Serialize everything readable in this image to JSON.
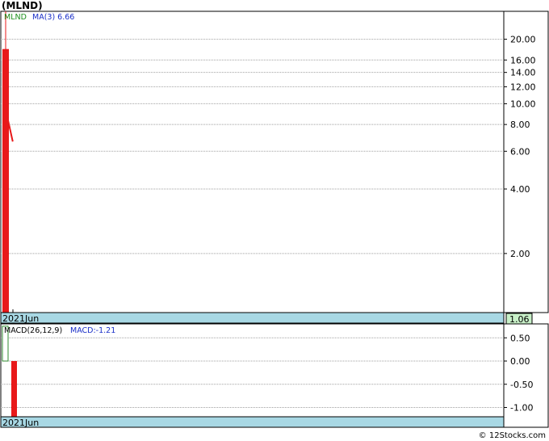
{
  "title": "(MLND)",
  "watermark": "© 12Stocks.com",
  "colors": {
    "price_bar": "#e8191a",
    "ma_line": "#e8191a",
    "macd_up": "#2f8a2f",
    "macd_down": "#e8191a",
    "axis_band": "#a8d8e4",
    "last_price_bg": "#c8f0c8",
    "grid": "#a0a0a0",
    "legend_ticker": "#1b8f1b",
    "legend_series": "#1a2fc8"
  },
  "chart_data": [
    {
      "type": "bar",
      "panel": "price",
      "scale": "log",
      "ylim": [
        1.06,
        27
      ],
      "yticks": [
        2,
        4,
        6,
        8,
        10,
        12,
        14,
        16,
        20
      ],
      "ytick_labels": [
        "2.00",
        "4.00",
        "6.00",
        "8.00",
        "10.00",
        "12.00",
        "14.00",
        "16.00",
        "20.00"
      ],
      "grid": true,
      "legend": [
        {
          "label": "MLND",
          "color": "#1b8f1b"
        },
        {
          "label": "MA(3)",
          "value": "6.66",
          "color": "#1a2fc8"
        }
      ],
      "x_label": "2021Jun",
      "last_price": "1.06",
      "bars": [
        {
          "high": 27,
          "top": 18,
          "low": 1.06
        }
      ],
      "ma_line": [
        {
          "bar_offset": 0.3,
          "value": 10
        },
        {
          "bar_offset": 1.6,
          "value": 6.66
        }
      ]
    },
    {
      "type": "bar",
      "panel": "macd",
      "legend": [
        {
          "label": "MACD(26,12,9)",
          "color": "#000000"
        },
        {
          "label": "MACD:",
          "value": "-1.21",
          "color": "#1a2fc8"
        }
      ],
      "ylim": [
        -1.2,
        0.8
      ],
      "yticks": [
        0.5,
        0,
        -0.5,
        -1.0
      ],
      "ytick_labels": [
        "0.50",
        "0.00",
        "-0.50",
        "-1.00"
      ],
      "grid": true,
      "x_label": "2021Jun",
      "bars": [
        {
          "value": 0.75,
          "kind": "up"
        },
        {
          "value": -1.21,
          "kind": "down"
        }
      ]
    }
  ]
}
